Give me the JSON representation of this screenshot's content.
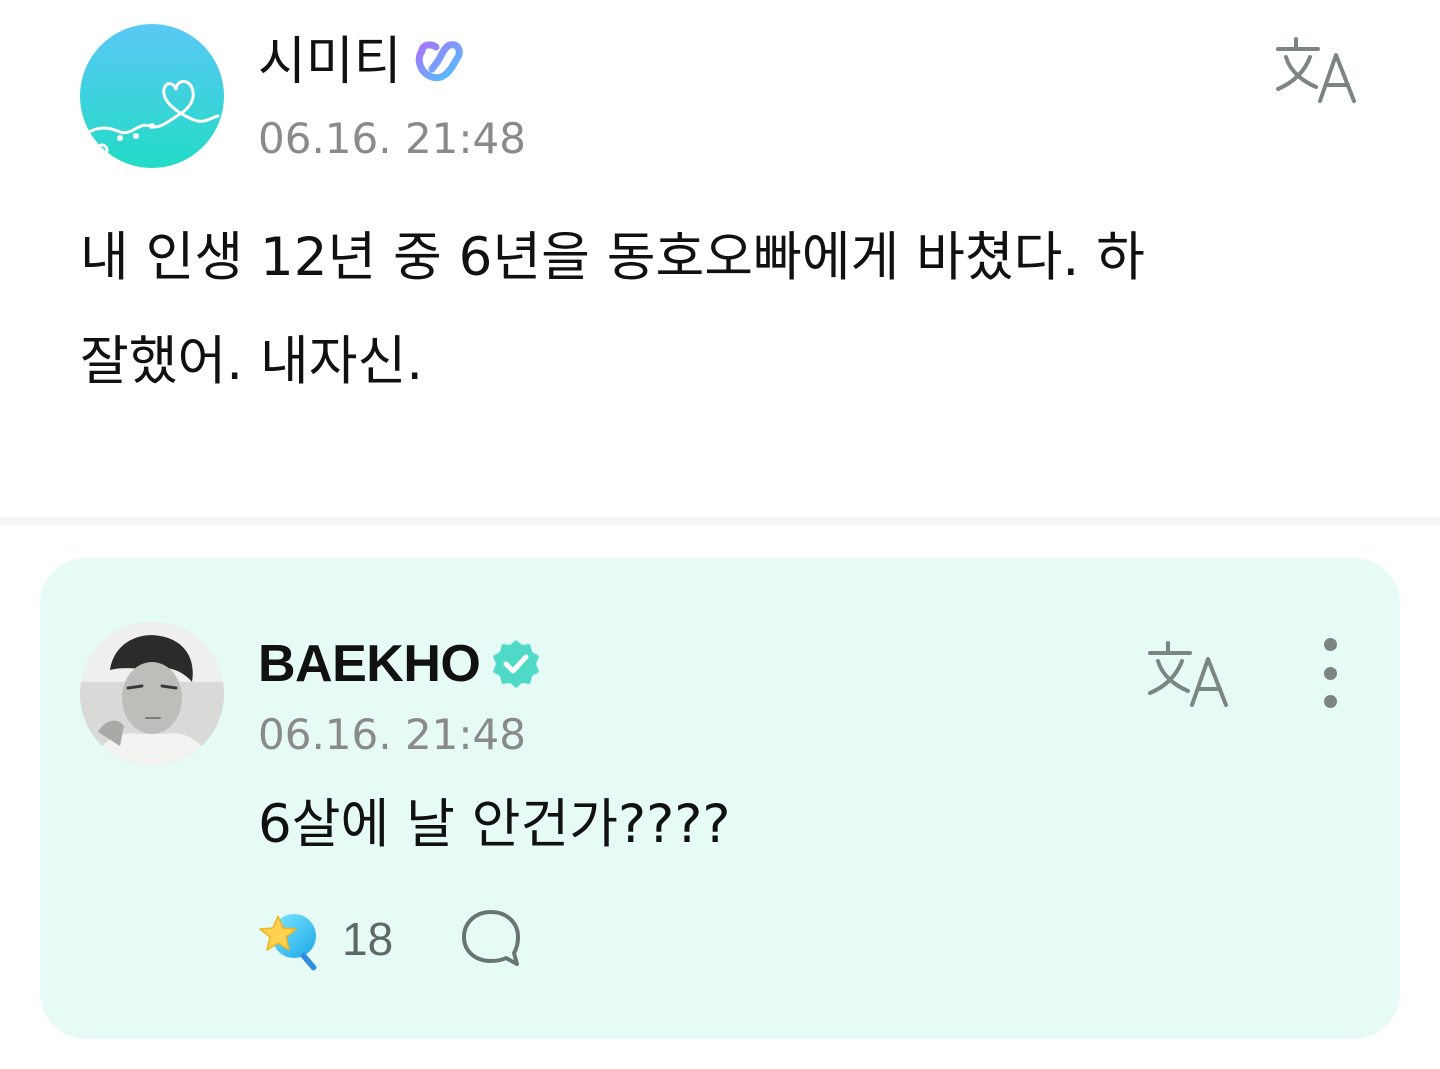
{
  "post": {
    "author": "시미티",
    "timestamp": "06.16. 21:48",
    "body_line1": "내 인생 12년 중 6년을 동호오빠에게 바쳤다. 하",
    "body_line2": "잘했어. 내자신."
  },
  "reply": {
    "author": "BAEKHO",
    "timestamp": "06.16. 21:48",
    "body": "6살에 날 안건가????",
    "cheer_count": "18"
  },
  "colors": {
    "accent_mint": "#4fd9c7",
    "card_bg": "#e6fbf6",
    "timestamp_gray": "#8a8a8a"
  },
  "icons": {
    "translate": "translate-icon",
    "membership_badge": "membership-badge-icon",
    "verified_badge": "verified-badge-icon",
    "more": "more-vertical-icon",
    "cheer": "cheer-star-icon",
    "comment": "comment-bubble-icon"
  }
}
